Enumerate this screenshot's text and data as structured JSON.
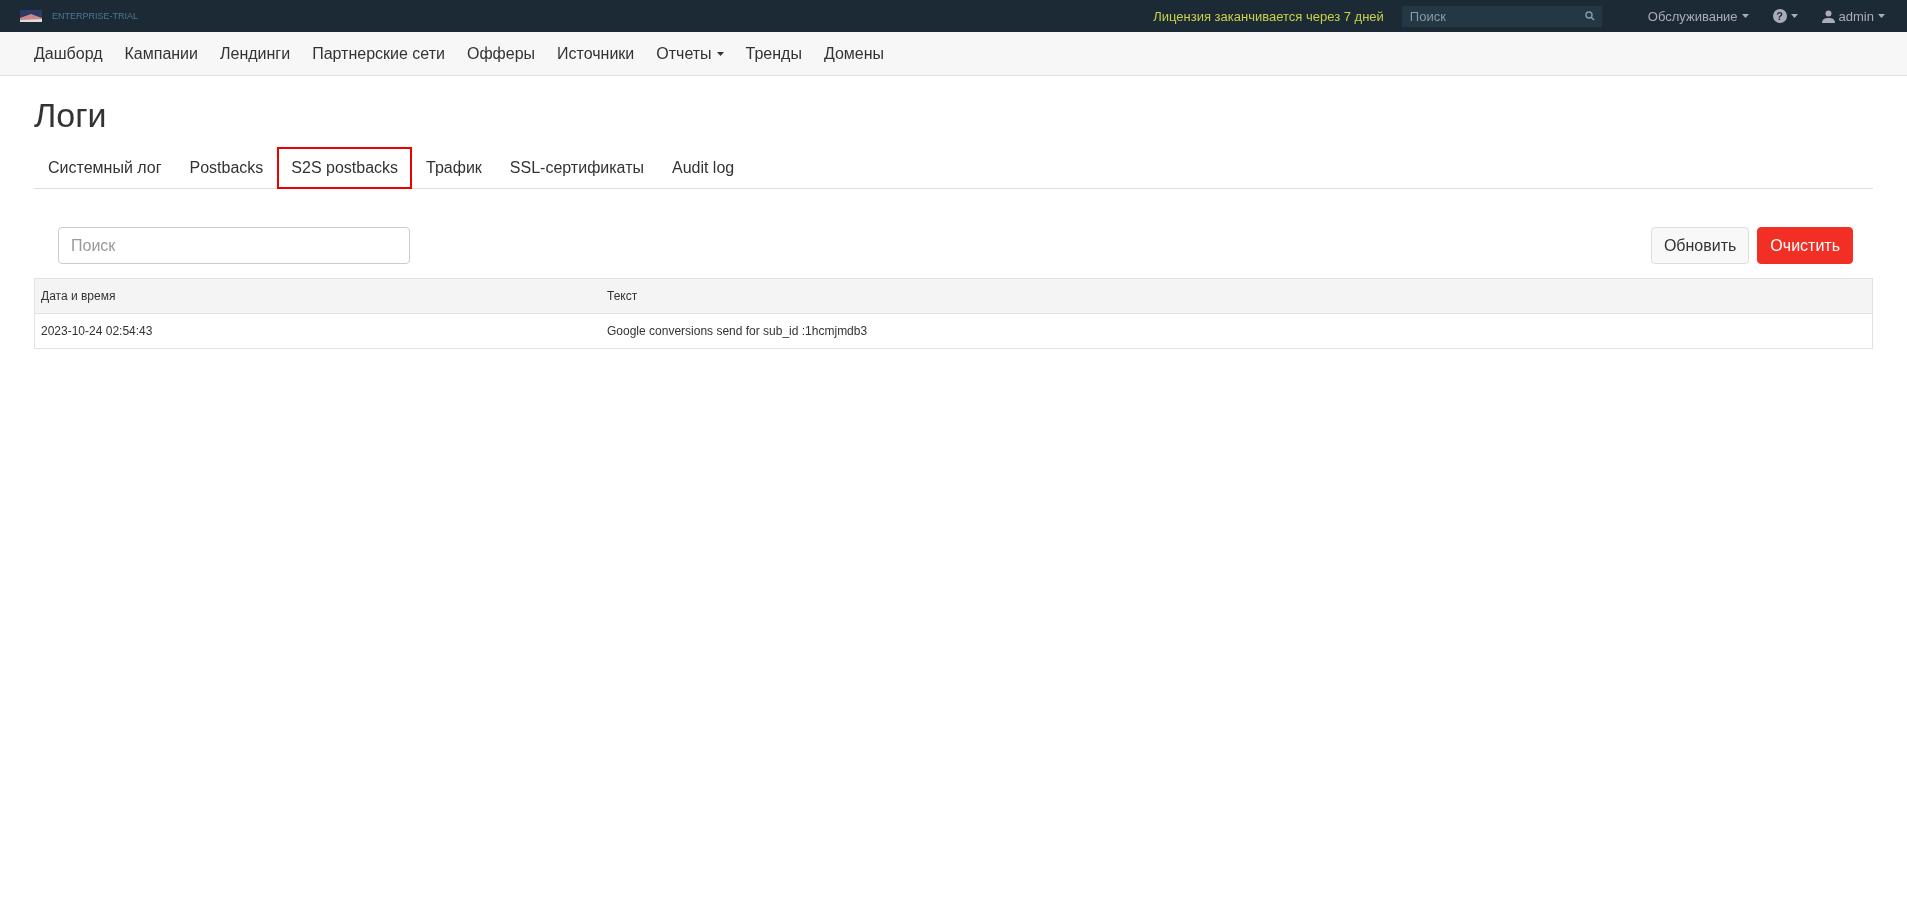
{
  "top_bar": {
    "brand": "ENTERPRISE-TRIAL",
    "license_notice": "Лицензия заканчивается через 7 дней",
    "search": {
      "placeholder": "Поиск"
    },
    "menus": [
      {
        "label": "Обслуживание",
        "kind": "text"
      },
      {
        "label": "?",
        "kind": "help"
      },
      {
        "label": "admin",
        "kind": "user"
      }
    ]
  },
  "nav": [
    {
      "label": "Дашборд",
      "dropdown": false
    },
    {
      "label": "Кампании",
      "dropdown": false
    },
    {
      "label": "Лендинги",
      "dropdown": false
    },
    {
      "label": "Партнерские сети",
      "dropdown": false
    },
    {
      "label": "Офферы",
      "dropdown": false
    },
    {
      "label": "Источники",
      "dropdown": false
    },
    {
      "label": "Отчеты",
      "dropdown": true
    },
    {
      "label": "Тренды",
      "dropdown": false
    },
    {
      "label": "Домены",
      "dropdown": false
    }
  ],
  "page_title": "Логи",
  "tabs": [
    {
      "label": "Системный лог",
      "selected": false
    },
    {
      "label": "Postbacks",
      "selected": false
    },
    {
      "label": "S2S postbacks",
      "selected": true
    },
    {
      "label": "Трафик",
      "selected": false
    },
    {
      "label": "SSL-сертификаты",
      "selected": false
    },
    {
      "label": "Audit log",
      "selected": false
    }
  ],
  "search": {
    "placeholder": "Поиск"
  },
  "buttons": [
    {
      "label": "Обновить",
      "kind": "default"
    },
    {
      "label": "Очистить",
      "kind": "danger"
    }
  ],
  "table": {
    "columns": [
      "Дата и время",
      "Текст"
    ],
    "rows": [
      [
        "2023-10-24 02:54:43",
        "Google conversions send for sub_id :1hcmjmdb3"
      ]
    ]
  }
}
